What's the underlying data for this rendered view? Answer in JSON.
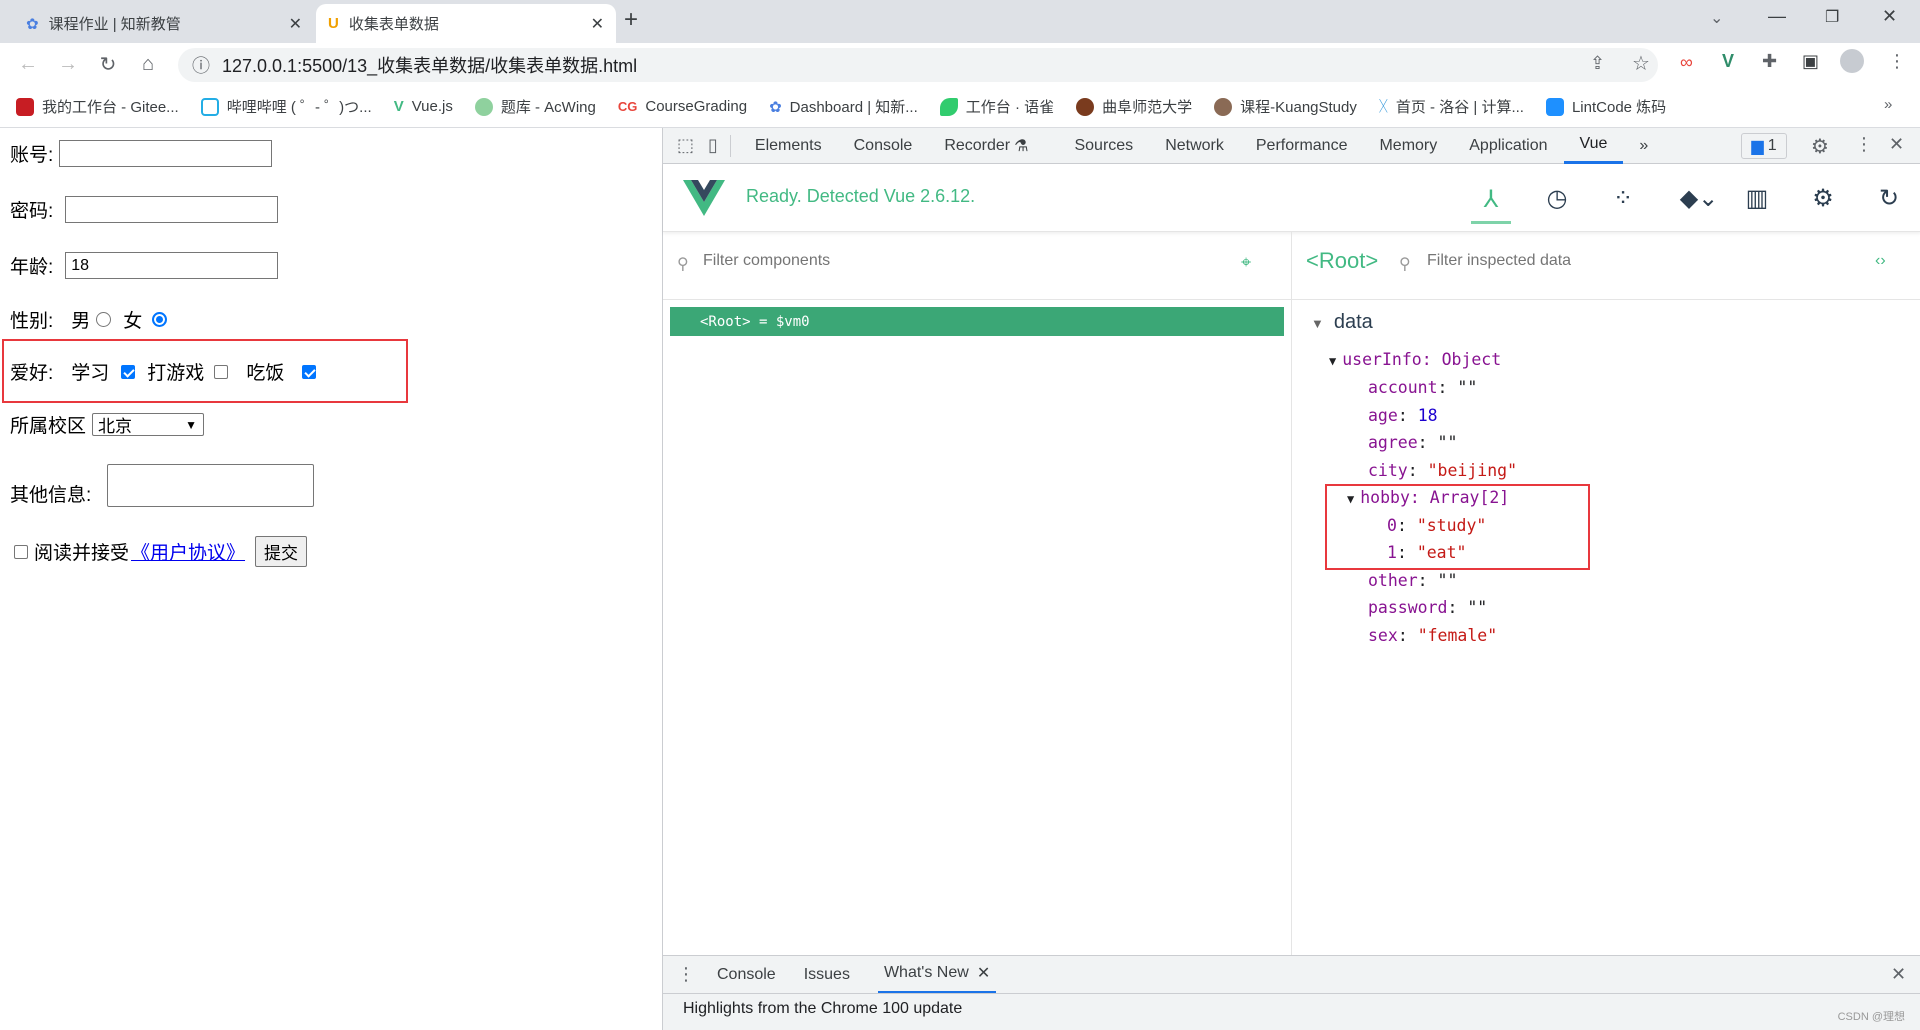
{
  "browser": {
    "tabs": [
      {
        "title": "课程作业 | 知新教管",
        "active": false
      },
      {
        "title": "收集表单数据",
        "active": true
      }
    ],
    "new_tab": "+",
    "url": "127.0.0.1:5500/13_收集表单数据/收集表单数据.html",
    "bookmarks": [
      "我的工作台 - Gitee...",
      "哔哩哔哩 ( ゜- ゜)つ...",
      "Vue.js",
      "题库 - AcWing",
      "CourseGrading",
      "Dashboard | 知新...",
      "工作台 · 语雀",
      "曲阜师范大学",
      "课程-KuangStudy",
      "首页 - 洛谷 | 计算...",
      "LintCode 炼码"
    ],
    "bookmarks_more": "»"
  },
  "form": {
    "account_label": "账号:",
    "account_value": "",
    "password_label": "密码:",
    "password_value": "",
    "age_label": "年龄:",
    "age_value": "18",
    "sex_label": "性别:",
    "sex_options": [
      {
        "label": "男",
        "checked": false
      },
      {
        "label": "女",
        "checked": true
      }
    ],
    "hobby_label": "爱好:",
    "hobby_options": [
      {
        "label": "学习",
        "checked": true
      },
      {
        "label": "打游戏",
        "checked": false
      },
      {
        "label": "吃饭",
        "checked": true
      }
    ],
    "city_label": "所属校区",
    "city_value": "北京",
    "other_label": "其他信息:",
    "other_value": "",
    "agree_text": "阅读并接受",
    "agree_link": "《用户协议》",
    "agree_checked": false,
    "submit_label": "提交"
  },
  "devtools": {
    "tabs": [
      "Elements",
      "Console",
      "Recorder",
      "Sources",
      "Network",
      "Performance",
      "Memory",
      "Application",
      "Vue"
    ],
    "active_tab": "Vue",
    "more": "»",
    "issues_count": "1",
    "vue": {
      "status": "Ready. Detected Vue 2.6.12.",
      "filter_components_placeholder": "Filter components",
      "selected_component": "<Root>",
      "filter_data_placeholder": "Filter inspected data",
      "root_row": "<Root> = $vm0",
      "section": "data",
      "tree": {
        "userInfo": "userInfo: Object",
        "fields": [
          {
            "key": "account",
            "value": "\"\"",
            "type": "str"
          },
          {
            "key": "age",
            "value": "18",
            "type": "num"
          },
          {
            "key": "agree",
            "value": "\"\"",
            "type": "str"
          },
          {
            "key": "city",
            "value": "\"beijing\"",
            "type": "str"
          }
        ],
        "hobby": "hobby: Array[2]",
        "hobby_items": [
          {
            "key": "0",
            "value": "\"study\""
          },
          {
            "key": "1",
            "value": "\"eat\""
          }
        ],
        "fields_after": [
          {
            "key": "other",
            "value": "\"\""
          },
          {
            "key": "password",
            "value": "\"\""
          },
          {
            "key": "sex",
            "value": "\"female\""
          }
        ]
      },
      "accent": "#42b983"
    },
    "drawer": {
      "tabs": [
        "Console",
        "Issues",
        "What's New"
      ],
      "active": "What's New",
      "message": "Highlights from the Chrome 100 update"
    }
  },
  "watermark": "CSDN @理想"
}
